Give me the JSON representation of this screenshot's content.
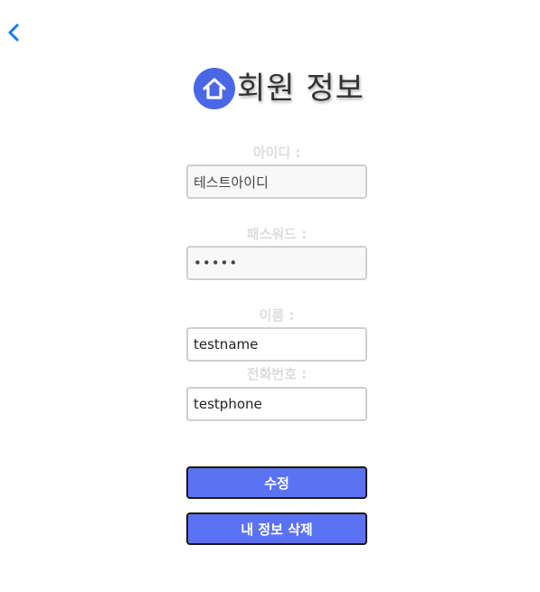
{
  "header": {
    "back_icon": "chevron-left-icon",
    "home_icon": "home-icon",
    "title": "회원 정보"
  },
  "form": {
    "id": {
      "label": "아이디 :",
      "value": "테스트아이디"
    },
    "password": {
      "label": "패스워드 :",
      "value": "•••••"
    },
    "name": {
      "label": "이름 :",
      "value": "testname"
    },
    "phone": {
      "label": "전화번호 :",
      "value": "testphone"
    }
  },
  "actions": {
    "edit_label": "수정",
    "delete_label": "내 정보 삭제"
  },
  "colors": {
    "accent": "#5b72f5",
    "home_icon_bg": "#4a67e8",
    "back_icon": "#1a7ae8",
    "label": "#dcdcdc"
  }
}
